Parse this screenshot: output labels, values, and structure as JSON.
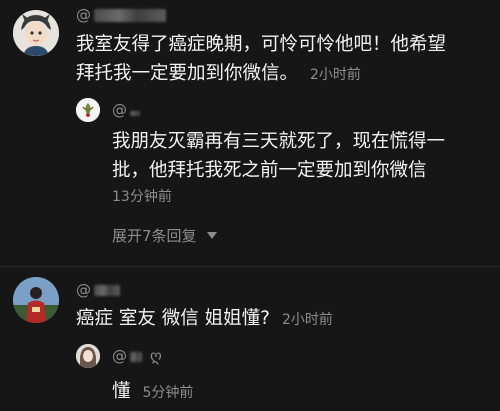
{
  "comments": [
    {
      "username": "@",
      "text_lines": [
        "我室友得了癌症晚期，可怜可怜他吧！他希望",
        "拜托我一定要加到你微信。"
      ],
      "time": "2小时前",
      "reply": {
        "username": "@",
        "text_lines": [
          "我朋友灭霸再有三天就死了，现在慌得一",
          "批，他拜托我死之前一定要加到你微信"
        ],
        "time": "13分钟前"
      },
      "expand_label": "展开7条回复"
    },
    {
      "username": "@",
      "text": "癌症 室友 微信 姐姐懂?",
      "time": "2小时前",
      "reply": {
        "username": "@",
        "author_icon": "ღ",
        "text": "懂",
        "time": "5分钟前"
      }
    }
  ],
  "icons": {
    "expand": "chevron-down-icon"
  }
}
